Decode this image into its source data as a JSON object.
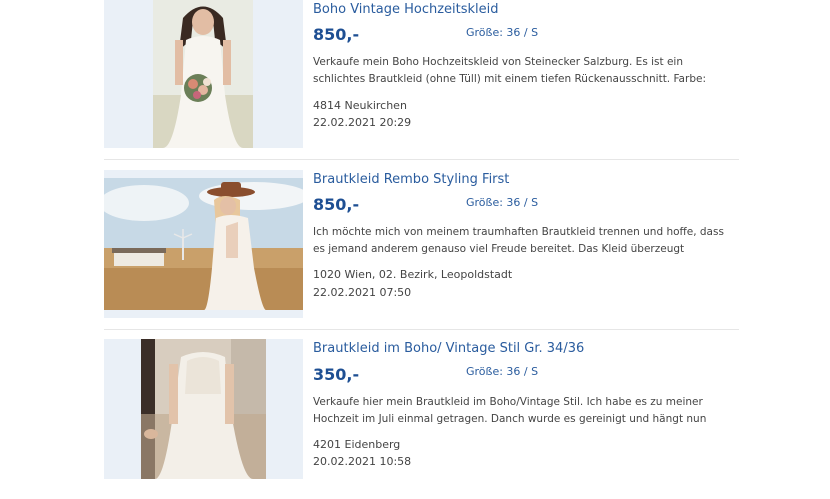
{
  "listings": [
    {
      "title": "Boho Vintage Hochzeitskleid",
      "price": "850,-",
      "size": "Größe: 36 / S",
      "description": "Verkaufe mein Boho Hochzeitskleid von Steinecker Salzburg. Es ist ein schlichtes Brautkleid (ohne Tüll) mit einem tiefen Rückenausschnitt. Farbe:",
      "location": "4814 Neukirchen",
      "date": "22.02.2021 20:29"
    },
    {
      "title": "Brautkleid Rembo Styling First",
      "price": "850,-",
      "size": "Größe: 36 / S",
      "description": "Ich möchte mich von meinem traumhaften Brautkleid trennen und hoffe, dass es jemand anderem genauso viel Freude bereitet. Das Kleid überzeugt",
      "location": "1020 Wien, 02. Bezirk, Leopoldstadt",
      "date": "22.02.2021 07:50"
    },
    {
      "title": "Brautkleid im Boho/ Vintage Stil Gr. 34/36",
      "price": "350,-",
      "size": "Größe: 36 / S",
      "description": "Verkaufe hier mein Brautkleid im Boho/Vintage Stil. Ich habe es zu meiner Hochzeit im Juli einmal getragen. Danch wurde es gereinigt und hängt nun",
      "location": "4201 Eidenberg",
      "date": "20.02.2021 10:58"
    }
  ],
  "colors": {
    "title": "#2a5c9e",
    "price": "#1e4f93",
    "thumb_bg": "#eaf0f7"
  }
}
